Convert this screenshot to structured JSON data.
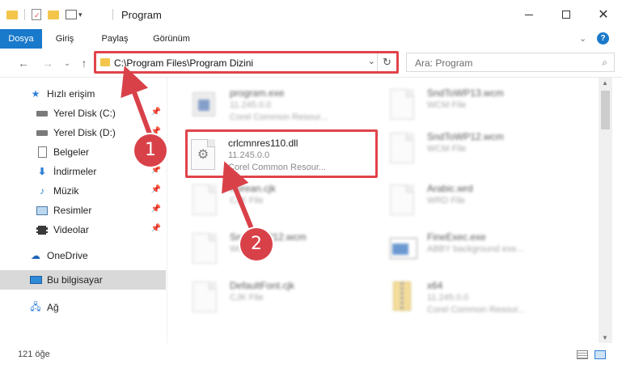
{
  "window": {
    "title": "Program",
    "minimize_icon": "minimize-icon",
    "maximize_icon": "maximize-icon",
    "close_icon": "close-icon"
  },
  "ribbon": {
    "tabs": [
      {
        "label": "Dosya",
        "active": true
      },
      {
        "label": "Giriş",
        "active": false
      },
      {
        "label": "Paylaş",
        "active": false
      },
      {
        "label": "Görünüm",
        "active": false
      }
    ],
    "accent_color": "#1979ca"
  },
  "address": {
    "path": "C:\\Program Files\\Program Dizini"
  },
  "search": {
    "placeholder": "Ara: Program"
  },
  "sidebar": {
    "items": [
      {
        "label": "Hızlı erişim",
        "icon": "star-icon",
        "pinned": false
      },
      {
        "label": "Yerel Disk (C:)",
        "icon": "drive-icon",
        "pinned": true
      },
      {
        "label": "Yerel Disk (D:)",
        "icon": "drive-icon",
        "pinned": true
      },
      {
        "label": "Belgeler",
        "icon": "documents-icon",
        "pinned": true
      },
      {
        "label": "İndirmeler",
        "icon": "download-icon",
        "pinned": true
      },
      {
        "label": "Müzik",
        "icon": "music-icon",
        "pinned": true
      },
      {
        "label": "Resimler",
        "icon": "pictures-icon",
        "pinned": true
      },
      {
        "label": "Videolar",
        "icon": "videos-icon",
        "pinned": true
      },
      {
        "label": "OneDrive",
        "icon": "cloud-icon",
        "pinned": false
      },
      {
        "label": "Bu bilgisayar",
        "icon": "computer-icon",
        "pinned": false,
        "selected": true
      },
      {
        "label": "Ağ",
        "icon": "network-icon",
        "pinned": false
      }
    ]
  },
  "files": [
    {
      "name": "program.exe",
      "line2": "11.245.0.0",
      "line3": "Corel Common Resour..."
    },
    {
      "name": "SndToWP13.wcm",
      "line2": "WCM File",
      "line3": ""
    },
    {
      "name": "crlcmnres110.dll",
      "line2": "11.245.0.0",
      "line3": "Corel Common Resour..."
    },
    {
      "name": "SndToWP12.wcm",
      "line2": "WCM File",
      "line3": ""
    },
    {
      "name": "Korean.cjk",
      "line2": "CJK File",
      "line3": ""
    },
    {
      "name": "Arabic.wrd",
      "line2": "WRD File",
      "line3": ""
    },
    {
      "name": "SndToWP12.wcm",
      "line2": "WCM File",
      "line3": ""
    },
    {
      "name": "FineExec.exe",
      "line2": "ABBY background exe...",
      "line3": ""
    },
    {
      "name": "DefaultFont.cjk",
      "line2": "CJK File",
      "line3": ""
    },
    {
      "name": "x64",
      "line2": "11.245.0.0",
      "line3": "Corel Common Resour..."
    }
  ],
  "status": {
    "count": "121 öğe"
  },
  "callouts": [
    "1",
    "2"
  ],
  "highlight_color": "#e0434b"
}
